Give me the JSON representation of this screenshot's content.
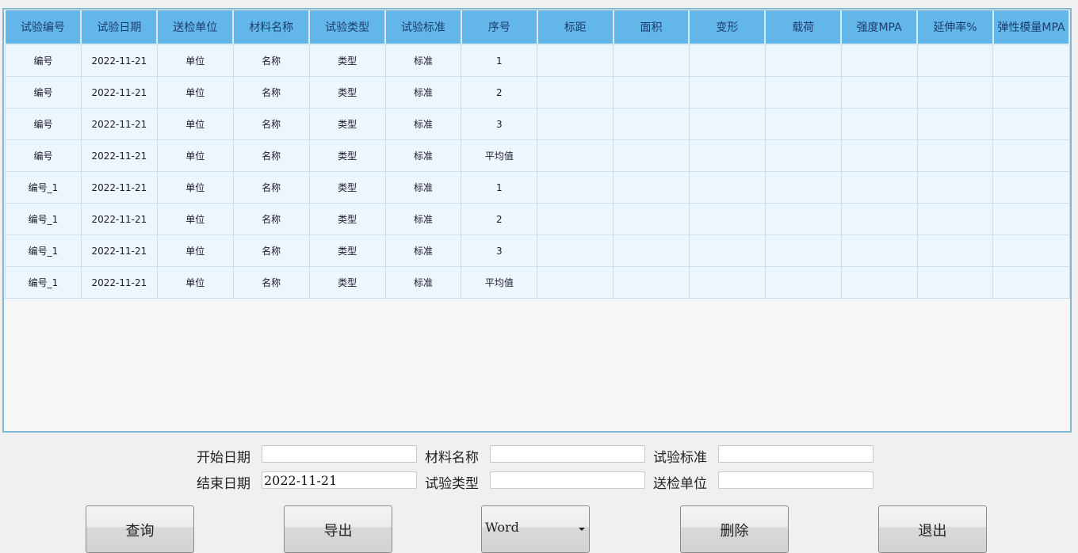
{
  "table": {
    "columns": [
      "试验编号",
      "试验日期",
      "送检单位",
      "材料名称",
      "试验类型",
      "试验标准",
      "序号",
      "标距",
      "面积",
      "变形",
      "载荷",
      "强度MPA",
      "延伸率%",
      "弹性模量MPA"
    ],
    "rows": [
      [
        "编号",
        "2022-11-21",
        "单位",
        "名称",
        "类型",
        "标准",
        "1",
        "",
        "",
        "",
        "",
        "",
        "",
        ""
      ],
      [
        "编号",
        "2022-11-21",
        "单位",
        "名称",
        "类型",
        "标准",
        "2",
        "",
        "",
        "",
        "",
        "",
        "",
        ""
      ],
      [
        "编号",
        "2022-11-21",
        "单位",
        "名称",
        "类型",
        "标准",
        "3",
        "",
        "",
        "",
        "",
        "",
        "",
        ""
      ],
      [
        "编号",
        "2022-11-21",
        "单位",
        "名称",
        "类型",
        "标准",
        "平均值",
        "",
        "",
        "",
        "",
        "",
        "",
        ""
      ],
      [
        "编号_1",
        "2022-11-21",
        "单位",
        "名称",
        "类型",
        "标准",
        "1",
        "",
        "",
        "",
        "",
        "",
        "",
        ""
      ],
      [
        "编号_1",
        "2022-11-21",
        "单位",
        "名称",
        "类型",
        "标准",
        "2",
        "",
        "",
        "",
        "",
        "",
        "",
        ""
      ],
      [
        "编号_1",
        "2022-11-21",
        "单位",
        "名称",
        "类型",
        "标准",
        "3",
        "",
        "",
        "",
        "",
        "",
        "",
        ""
      ],
      [
        "编号_1",
        "2022-11-21",
        "单位",
        "名称",
        "类型",
        "标准",
        "平均值",
        "",
        "",
        "",
        "",
        "",
        "",
        ""
      ]
    ]
  },
  "filters": {
    "start_date": {
      "label": "开始日期",
      "value": ""
    },
    "end_date": {
      "label": "结束日期",
      "value": "2022-11-21"
    },
    "material_name": {
      "label": "材料名称",
      "value": ""
    },
    "test_type": {
      "label": "试验类型",
      "value": ""
    },
    "test_standard": {
      "label": "试验标准",
      "value": ""
    },
    "submit_unit": {
      "label": "送检单位",
      "value": ""
    }
  },
  "buttons": {
    "query": "查询",
    "export": "导出",
    "format_selected": "Word",
    "delete": "删除",
    "exit": "退出"
  }
}
